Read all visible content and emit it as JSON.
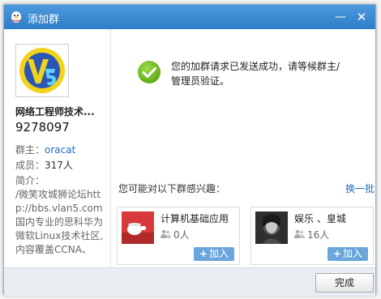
{
  "window": {
    "title": "添加群",
    "minimize_label": "—",
    "close_label": "✕"
  },
  "group": {
    "name": "网络工程师技术...",
    "id": "9278097",
    "owner_label": "群主：",
    "owner": "oracat",
    "members_label": "成员：",
    "members": "317人",
    "intro_label": "简介：",
    "intro": "/微笑攻城狮论坛http://bbs.vlan5.com国内专业的思科华为微软Linux技术社区,内容覆盖CCNA、"
  },
  "message": {
    "text": "您的加群请求已发送成功，请等候群主/管理员验证。"
  },
  "recommend": {
    "label": "您可能对以下群感兴趣：",
    "refresh": "换一批",
    "cards": [
      {
        "name": "计算机基础应用",
        "count": "0人",
        "join": "加入"
      },
      {
        "name": "娱乐 、皇城",
        "count": "16人",
        "join": "加入"
      }
    ]
  },
  "footer": {
    "done": "完成"
  },
  "icons": {
    "app": "qq-penguin-icon",
    "success": "checkmark-circle-icon",
    "members": "people-icon"
  },
  "colors": {
    "titlebar": "#3a8bd3",
    "success": "#6dbb1f",
    "link": "#1e6fc4",
    "join": "#6aa6dc"
  }
}
